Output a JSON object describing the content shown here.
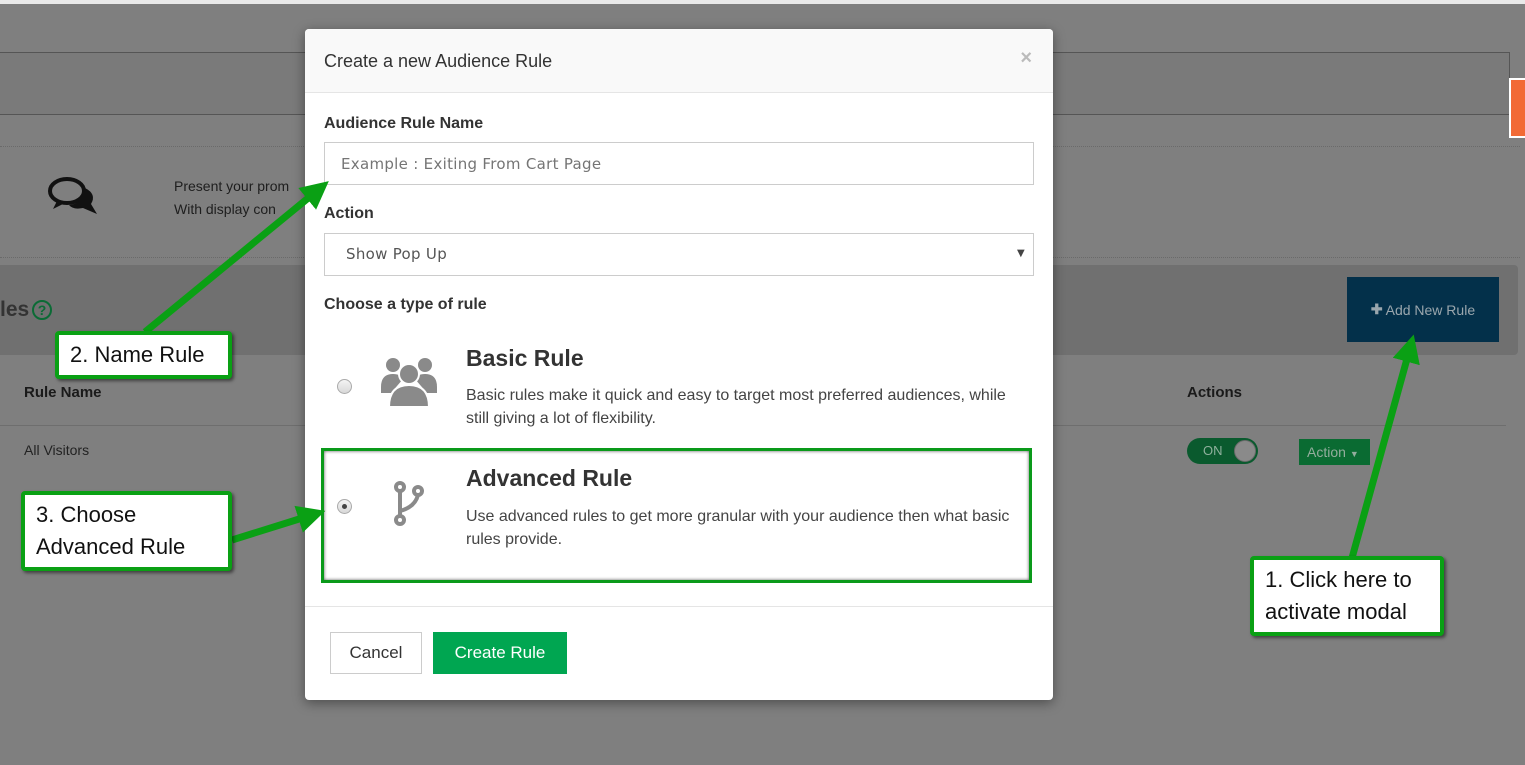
{
  "background": {
    "promo_lines": [
      "Present your prom",
      "With display con"
    ],
    "section_title": "les",
    "add_button": "Add New Rule",
    "table_headers": {
      "rule_name": "Rule Name",
      "actions": "Actions"
    },
    "rows": [
      {
        "name": "All Visitors",
        "toggle": "ON",
        "action": "Action"
      }
    ]
  },
  "modal": {
    "title": "Create a new Audience Rule",
    "close": "×",
    "name_label": "Audience Rule Name",
    "name_placeholder": "Example : Exiting From Cart Page",
    "name_value": "",
    "action_label": "Action",
    "action_value": "Show Pop Up",
    "type_label": "Choose a type of rule",
    "rules": [
      {
        "title": "Basic Rule",
        "desc": "Basic rules make it quick and easy to target most preferred audiences, while still giving a lot of flexibility.",
        "icon": "users-icon",
        "selected": false
      },
      {
        "title": "Advanced Rule",
        "desc": "Use advanced rules to get more granular with your audience then what basic rules provide.",
        "icon": "code-fork-icon",
        "selected": true
      }
    ],
    "cancel": "Cancel",
    "create": "Create Rule"
  },
  "annotations": {
    "step1": "1. Click here to activate modal",
    "step2": "2. Name Rule",
    "step3": "3. Choose Advanced Rule"
  },
  "colors": {
    "primary_green": "#00a651",
    "annotation_green": "#0aa014",
    "add_button": "#03304a"
  }
}
